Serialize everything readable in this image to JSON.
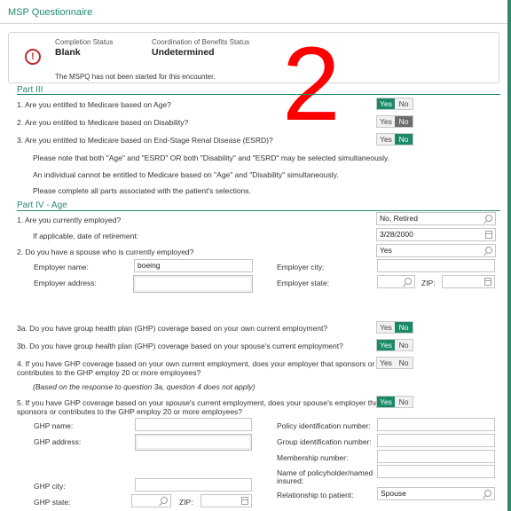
{
  "window": {
    "title": "MSP Questionnaire"
  },
  "status": {
    "completion_label": "Completion Status",
    "completion_value": "Blank",
    "cob_label": "Coordination of Benefits Status",
    "cob_value": "Undetermined",
    "message": "The MSPQ has not been started for this encounter."
  },
  "overlay_number": "2",
  "part3": {
    "heading": "Part III",
    "q1": {
      "text": "1. Are you entitled to Medicare based on Age?",
      "yes": "Yes",
      "no": "No",
      "selected": "Yes"
    },
    "q2": {
      "text": "2. Are you entitled to Medicare based on Disability?",
      "yes": "Yes",
      "no": "No",
      "selected": "No"
    },
    "q3": {
      "text": "3. Are you entitled to Medicare based on End-Stage Renal Disease (ESRD)?",
      "yes": "Yes",
      "no": "No",
      "selected": "No"
    },
    "notes": [
      "Please note that both \"Age\" and \"ESRD\" OR both \"Disability\" and \"ESRD\" may be selected simultaneously.",
      "An individual cannot be entitled to Medicare based on \"Age\" and \"Disability\" simultaneously.",
      "Please complete all parts associated with the patient's selections."
    ]
  },
  "part4": {
    "heading": "Part IV - Age",
    "q1": {
      "text": "1. Are you currently employed?",
      "value": "No, Retired"
    },
    "retirement": {
      "text": "If applicable, date of retirement:",
      "value": "3/28/2000"
    },
    "q2": {
      "text": "2. Do you have a spouse who is currently employed?",
      "value": "Yes"
    },
    "employer_name_label": "Employer name:",
    "employer_name_value": "boeing",
    "employer_address_label": "Employer address:",
    "employer_city_label": "Employer city:",
    "employer_state_label": "Employer state:",
    "zip_label": "ZIP:",
    "q3a": {
      "text": "3a. Do you have group health plan (GHP) coverage based on your own current employment?",
      "yes": "Yes",
      "no": "No",
      "selected": "No"
    },
    "q3b": {
      "text": "3b. Do you have group health plan (GHP) coverage based on your spouse's current employment?",
      "yes": "Yes",
      "no": "No",
      "selected": "Yes"
    },
    "q4": {
      "line1": "4. If you have GHP coverage based on your own current employment, does your employer that sponsors or",
      "line2": "contributes to the GHP employ 20 or more employees?",
      "yes": "Yes",
      "no": "No",
      "selected": ""
    },
    "q4_note": "(Based on the response to question 3a, question 4 does not apply)",
    "q5": {
      "line1": "5. If you have GHP coverage based on your spouse's current employment, does your spouse's employer that",
      "line2": "sponsors or contributes to the GHP employ 20 or more employees?",
      "yes": "Yes",
      "no": "No",
      "selected": "Yes"
    },
    "ghp_name_label": "GHP name:",
    "ghp_address_label": "GHP address:",
    "ghp_city_label": "GHP city:",
    "ghp_state_label": "GHP state:",
    "ghp_zip_label": "ZIP:",
    "policy_id_label": "Policy identification number:",
    "group_id_label": "Group identification number:",
    "membership_label": "Membership number:",
    "policyholder_line1": "Name of policyholder/named",
    "policyholder_line2": "insured:",
    "relationship_label": "Relationship to patient:",
    "relationship_value": "Spouse"
  },
  "colors": {
    "accent": "#2b8a6e",
    "selected": "#1a8a66",
    "selected_gray": "#6d6d6d",
    "alert": "#c2272d",
    "overlay": "#ff0000"
  },
  "icons": [
    "alert-icon",
    "search-icon",
    "calendar-icon"
  ]
}
